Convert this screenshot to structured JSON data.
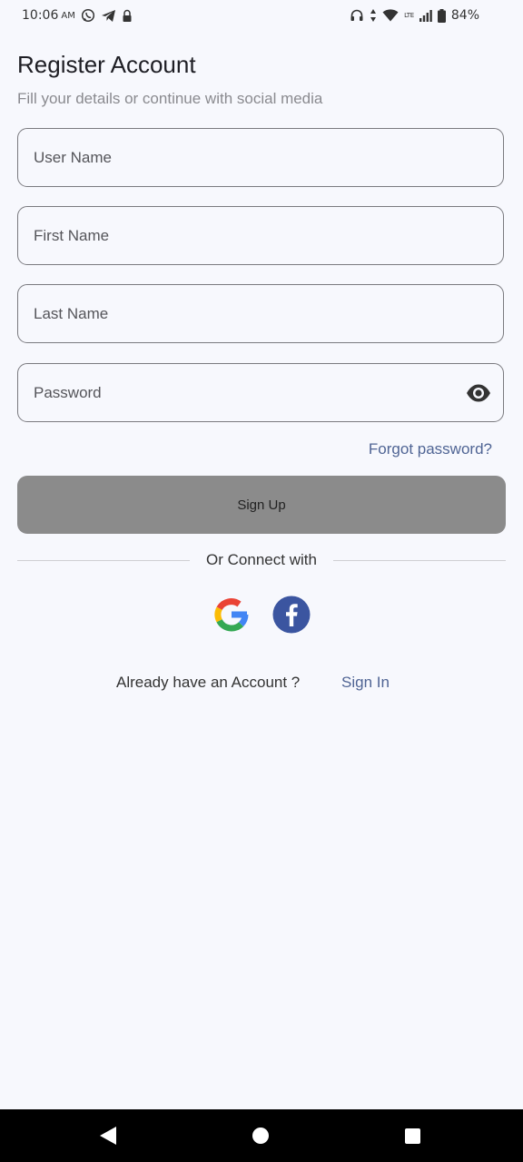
{
  "status_bar": {
    "time": "10:06",
    "ampm": "AM",
    "network": "LTE",
    "battery": "84%",
    "icons": [
      "whatsapp-icon",
      "telegram-icon",
      "lock-icon",
      "headphones-icon",
      "data-arrows-icon",
      "wifi-icon",
      "signal-icon",
      "battery-icon"
    ]
  },
  "header": {
    "title": "Register Account",
    "subtitle": "Fill your details or continue with social media"
  },
  "form": {
    "username_placeholder": "User Name",
    "firstname_placeholder": "First Name",
    "lastname_placeholder": "Last Name",
    "password_placeholder": "Password",
    "password_toggle_icon": "eye-icon",
    "forgot_password": "Forgot password?",
    "signup_label": "Sign Up"
  },
  "social": {
    "divider_text": "Or Connect with",
    "providers": [
      "google-icon",
      "facebook-icon"
    ]
  },
  "footer": {
    "prompt": "Already have an Account ?",
    "signin_label": "Sign In"
  },
  "colors": {
    "background": "#f7f8fd",
    "field_border": "#7a7a7f",
    "button": "#8b8b8b",
    "link": "#4f6494",
    "facebook": "#3b55a0"
  }
}
